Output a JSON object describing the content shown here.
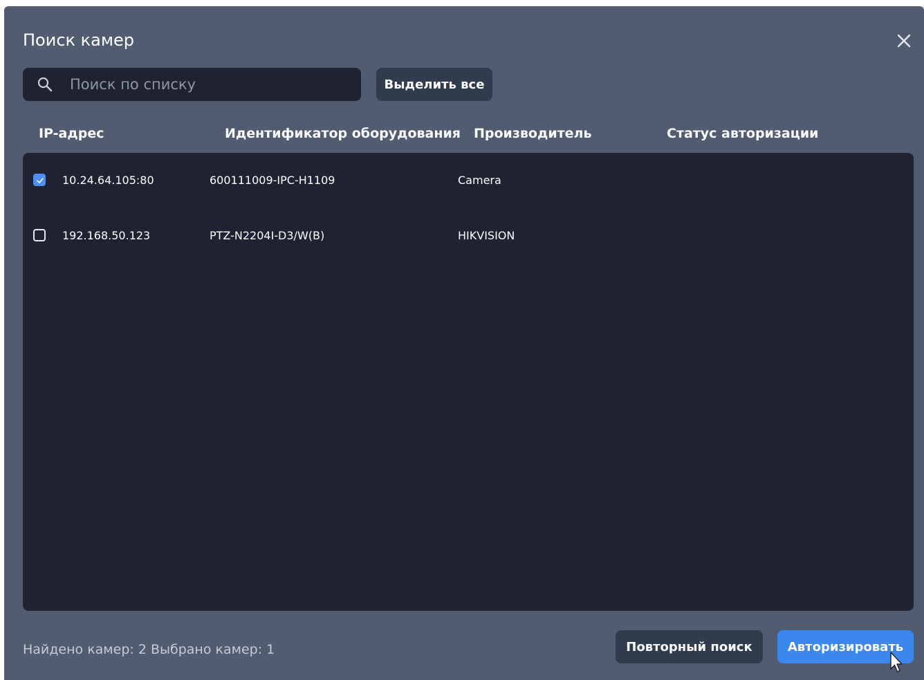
{
  "dialog": {
    "title": "Поиск камер",
    "close_icon": "close-icon"
  },
  "search": {
    "placeholder": "Поиск по списку",
    "value": "",
    "icon": "search-icon"
  },
  "select_all_label": "Выделить все",
  "columns": [
    "IP-адрес",
    "Идентификатор оборудования",
    "Производитель",
    "Статус авторизации"
  ],
  "rows": [
    {
      "checked": true,
      "ip": "10.24.64.105:80",
      "device_id": "600111009-IPC-H1109",
      "manufacturer": "Camera",
      "auth_status": ""
    },
    {
      "checked": false,
      "ip": "192.168.50.123",
      "device_id": "PTZ-N2204I-D3/W(B)",
      "manufacturer": "HIKVISION",
      "auth_status": ""
    }
  ],
  "footer": {
    "status": "Найдено камер: 2 Выбрано камер: 1",
    "retry_label": "Повторный поиск",
    "authorize_label": "Авторизировать"
  },
  "colors": {
    "dialog_bg": "#515c71",
    "panel_bg": "#1f2331",
    "accent": "#3b87ee"
  }
}
